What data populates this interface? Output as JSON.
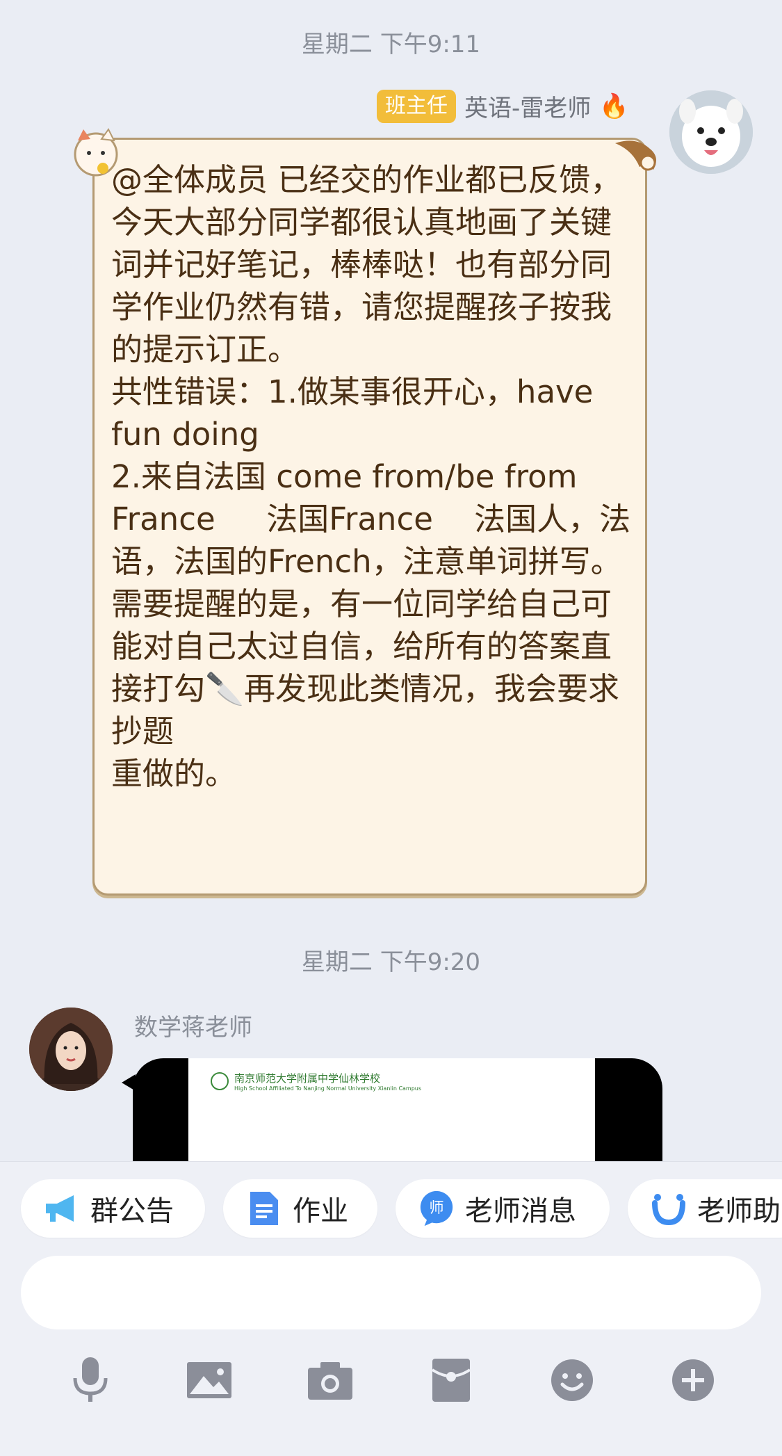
{
  "messages": {
    "first": {
      "time": "星期二 下午9:11",
      "role_badge": "班主任",
      "sender": "英语-雷老师",
      "text": "@全体成员 已经交的作业都已反馈，今天大部分同学都很认真地画了关键词并记好笔记，棒棒哒！也有部分同学作业仍然有错，请您提醒孩子按我的提示订正。\n共性错误：1.做某事很开心，have fun doing\n2.来自法国 come from/be from France　  法国France　 法国人，法语，法国的French，注意单词拼写。\n需要提醒的是，有一位同学给自己可能对自己太过自信，给所有的答案直接打勾🔪再发现此类情况，我会要求抄题\n重做的。"
    },
    "second": {
      "time": "星期二 下午9:20",
      "sender": "数学蒋老师",
      "image_caption": "南京师范大学附属中学仙林学校",
      "image_caption_en": "High School Affiliated To Nanjing Normal University Xianlin Campus"
    }
  },
  "quick_actions": [
    {
      "label": "群公告",
      "icon": "megaphone-icon"
    },
    {
      "label": "作业",
      "icon": "document-icon"
    },
    {
      "label": "老师消息",
      "icon": "teacher-chat-icon"
    },
    {
      "label": "老师助",
      "icon": "assistant-icon"
    }
  ],
  "input": {
    "placeholder": ""
  },
  "toolbar": [
    "microphone-icon",
    "image-icon",
    "camera-icon",
    "redpacket-icon",
    "emoji-icon",
    "plus-icon"
  ],
  "colors": {
    "badge": "#f2bd3a",
    "bubble_bg": "#fdf4e6",
    "bubble_text": "#4a2f14",
    "icon_gray": "#8b8e99"
  }
}
